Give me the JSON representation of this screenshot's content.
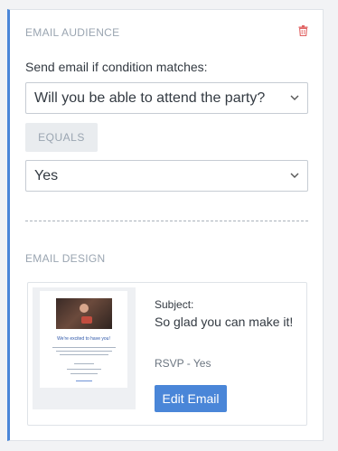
{
  "audience": {
    "section_title": "Email Audience",
    "delete_icon": "trash-icon",
    "condition_label": "Send email if condition matches:",
    "question_select": {
      "value": "Will you be able to attend the party?",
      "icon": "chevron-down-icon"
    },
    "operator_label": "EQUALS",
    "answer_select": {
      "value": "Yes",
      "icon": "chevron-down-icon"
    }
  },
  "design": {
    "section_title": "Email Design",
    "thumbnail": {
      "headline": "We're excited to have you!"
    },
    "subject_label": "Subject:",
    "subject_value": "So glad you can make it!",
    "template_name": "RSVP - Yes",
    "edit_button_label": "Edit Email"
  },
  "colors": {
    "accent": "#4a86d8",
    "delete_icon": "#e06060",
    "muted_text": "#9aa5b1"
  }
}
